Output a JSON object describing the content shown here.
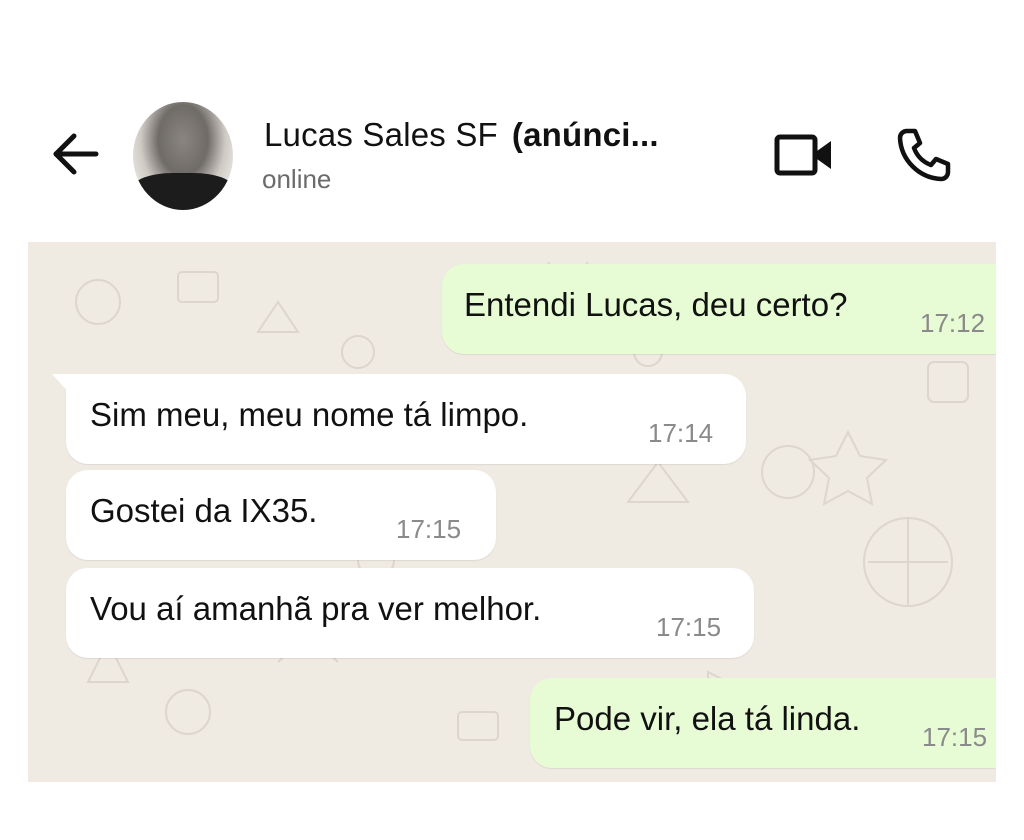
{
  "header": {
    "contact_name": "Lucas Sales SF",
    "contact_suffix": "(anúnci...",
    "status": "online",
    "back_icon": "arrow-left-icon",
    "video_icon": "video-camera-icon",
    "call_icon": "phone-icon"
  },
  "messages": [
    {
      "direction": "out",
      "text": "Entendi Lucas, deu certo?",
      "time": "17:12"
    },
    {
      "direction": "in",
      "text": "Sim meu, meu nome tá limpo.",
      "time": "17:14"
    },
    {
      "direction": "in",
      "text": "Gostei da IX35.",
      "time": "17:15"
    },
    {
      "direction": "in",
      "text": "Vou aí amanhã pra ver melhor.",
      "time": "17:15"
    },
    {
      "direction": "out",
      "text": "Pode vir, ela tá linda.",
      "time": "17:15"
    }
  ],
  "colors": {
    "outgoing_bubble": "#e7fcd5",
    "incoming_bubble": "#ffffff",
    "chat_background": "#efeae2"
  }
}
